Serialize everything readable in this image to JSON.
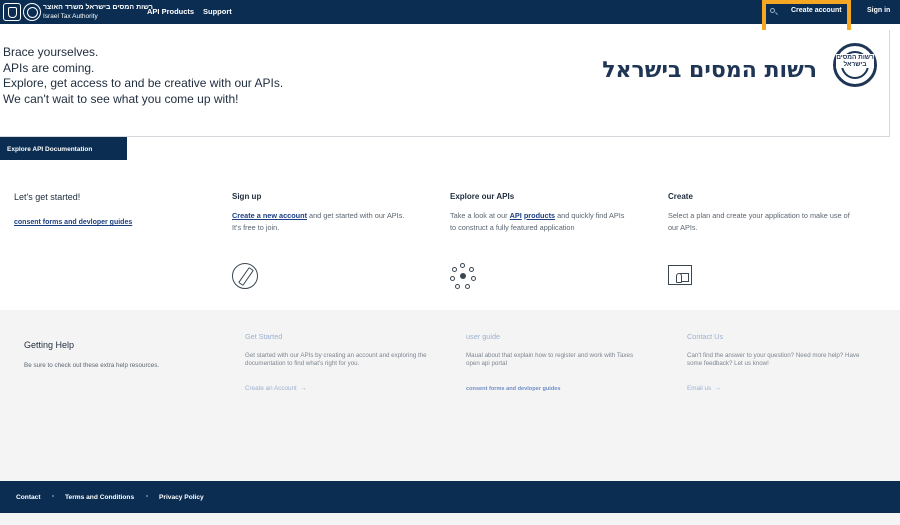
{
  "topbar": {
    "logo_hebrew": "רשות המסים בישראל משרד האוצר",
    "logo_english": "Israel Tax Authority",
    "nav": [
      "API Products",
      "Support"
    ],
    "create_account": "Create account",
    "sign_in": "Sign in"
  },
  "hero": {
    "lines": [
      "Brace yourselves.",
      "APIs are coming.",
      "Explore, get access to and be creative with our APIs.",
      "We can't wait to see what you come up with!"
    ],
    "brand_hebrew": "רשות המסים בישראל",
    "logo_label": "רשות המסים בישראל",
    "explore_button": "Explore API Documentation"
  },
  "started": {
    "title": "Let's get started!",
    "guides_link": "consent forms and devloper guides",
    "signup": {
      "heading": "Sign up",
      "link": "Create a new account",
      "text_after": " and get started with our APIs.",
      "text2": "It's free to join."
    },
    "explore": {
      "heading": "Explore our APIs",
      "text_before": "Take a look at our ",
      "link1": "API",
      "link2": "products",
      "text_after": " and quickly find APIs to construct a fully featured application"
    },
    "create": {
      "heading": "Create",
      "text": "Select a plan and create your application to make use of our APIs."
    }
  },
  "help": {
    "title": "Getting Help",
    "subtitle": "Be sure to check out these extra help resources.",
    "get_started": {
      "heading": "Get Started",
      "text": "Get started with our APIs by creating an account and exploring the documentation to find what's right for you.",
      "link": "Create an Account"
    },
    "user_guide": {
      "heading": "user guide",
      "text": "Maual about that explain how to register and work with Taxes open api portal",
      "link": "consent forms and devloper guides"
    },
    "contact": {
      "heading": "Contact Us",
      "text": "Can't find the answer to your question? Need more help? Have some feedback? Let us know!",
      "link": "Email us"
    }
  },
  "footer": {
    "links": [
      "Contact",
      "Terms and Conditions",
      "Privacy Policy"
    ]
  },
  "colors": {
    "navy": "#0b2d52",
    "highlight": "#f5a623",
    "link": "#1b3f82"
  },
  "icons": [
    "search-icon",
    "pencil-icon",
    "network-icon",
    "app-window-icon",
    "arrow-right-icon"
  ]
}
